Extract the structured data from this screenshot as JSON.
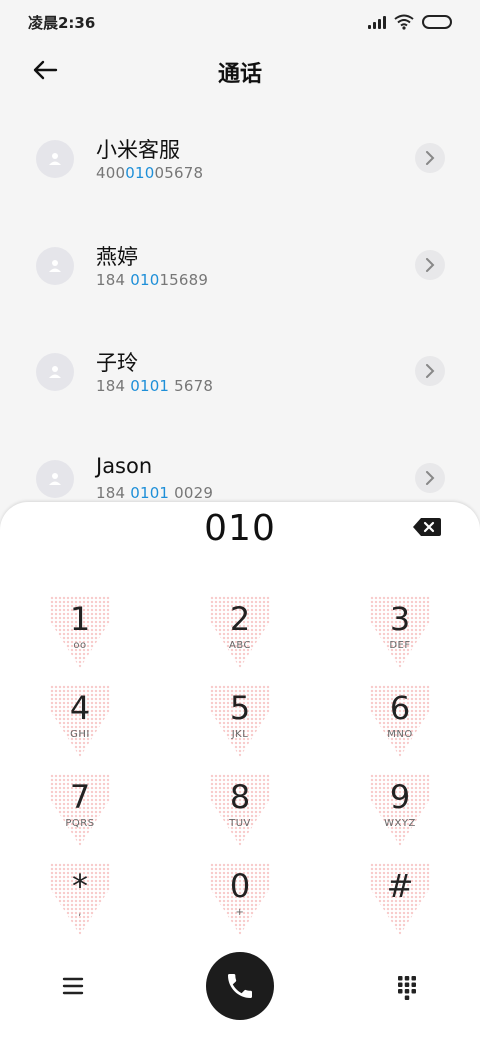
{
  "status_bar": {
    "time": "凌晨2:36"
  },
  "header": {
    "title": "通话"
  },
  "contacts": [
    {
      "name": "小米客服",
      "number_pre": "400",
      "number_hl": "010",
      "number_post": "05678"
    },
    {
      "name": "燕婷",
      "number_pre": "184 ",
      "number_hl": "010",
      "number_post": "15689"
    },
    {
      "name": "子玲",
      "number_pre": "184 ",
      "number_hl": "0101",
      "number_post": " 5678"
    },
    {
      "name": "Jason",
      "number_pre": "184 ",
      "number_hl": "0101",
      "number_post": " 0029"
    }
  ],
  "dialpad": {
    "input": "010",
    "keys": [
      {
        "digit": "1",
        "sub": "oo"
      },
      {
        "digit": "2",
        "sub": "ABC"
      },
      {
        "digit": "3",
        "sub": "DEF"
      },
      {
        "digit": "4",
        "sub": "GHI"
      },
      {
        "digit": "5",
        "sub": "JKL"
      },
      {
        "digit": "6",
        "sub": "MNO"
      },
      {
        "digit": "7",
        "sub": "PQRS"
      },
      {
        "digit": "8",
        "sub": "TUV"
      },
      {
        "digit": "9",
        "sub": "WXYZ"
      },
      {
        "digit": "*",
        "sub": ","
      },
      {
        "digit": "0",
        "sub": "+"
      },
      {
        "digit": "#",
        "sub": ""
      }
    ]
  },
  "colors": {
    "accent": "#1e8fd8",
    "call_button": "#1c1c1c",
    "background": "#f5f5f5"
  },
  "icons": {
    "back": "arrow-left-icon",
    "avatar": "person-icon",
    "chevron": "chevron-right-icon",
    "backspace": "backspace-icon",
    "menu": "menu-icon",
    "call": "phone-icon",
    "keypad": "keypad-icon"
  }
}
